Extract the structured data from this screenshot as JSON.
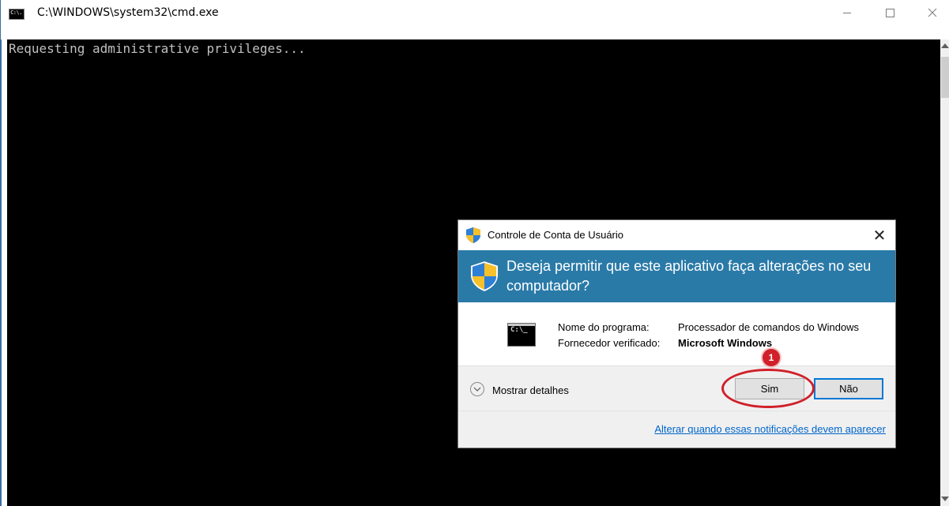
{
  "window": {
    "title": "C:\\WINDOWS\\system32\\cmd.exe",
    "icon": "cmd-icon",
    "icon_text": "C:\\."
  },
  "console": {
    "output": "Requesting administrative privileges..."
  },
  "uac_dialog": {
    "title": "Controle de Conta de Usuário",
    "question": "Deseja permitir que este aplicativo faça alterações no seu computador?",
    "program_icon_text": "C:\\_",
    "program_name_label": "Nome do programa:",
    "program_name_value": "Processador de comandos do Windows",
    "publisher_label": "Fornecedor verificado:",
    "publisher_value": "Microsoft Windows",
    "show_details_label": "Mostrar detalhes",
    "yes_button": "Sim",
    "no_button": "Não",
    "change_link": "Alterar quando essas notificações devem aparecer",
    "header_color": "#2a7aa8",
    "close_glyph": "✕"
  },
  "annotation": {
    "step_number": "1",
    "color": "#d0202a"
  }
}
